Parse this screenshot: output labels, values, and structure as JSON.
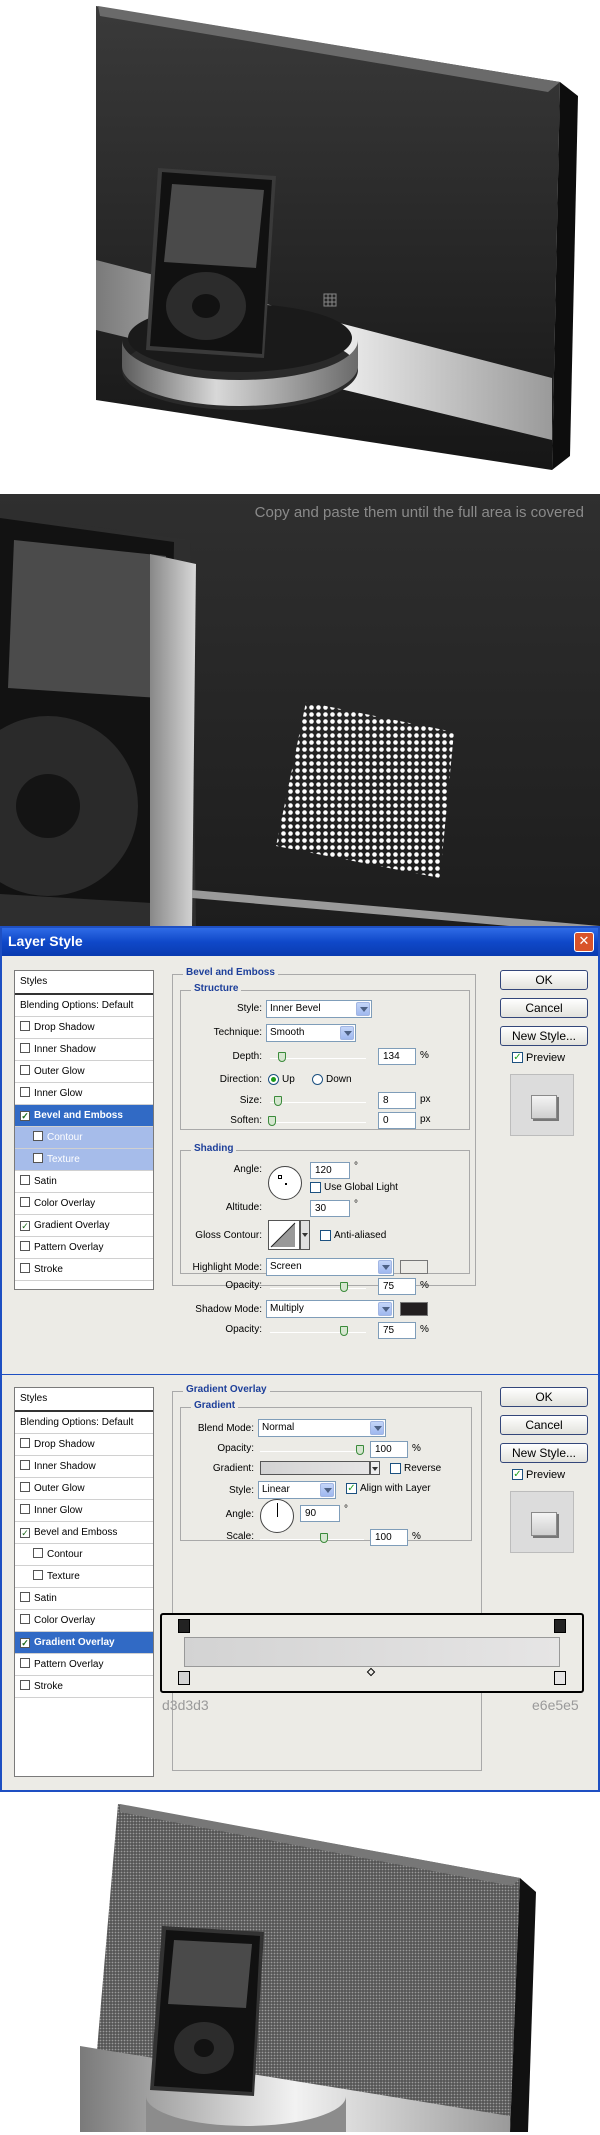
{
  "hint_text": "Copy and paste them until the full area is covered",
  "colors": {
    "dialog_bg": "#ecebe6",
    "titlebar": "#0f48c9",
    "selected": "#316ac5",
    "accent_title": "#1d3f9a",
    "gradient_start": "#d3d3d3",
    "gradient_end": "#e6e5e5"
  },
  "dialog1": {
    "title": "Layer Style",
    "buttons": {
      "ok": "OK",
      "cancel": "Cancel",
      "new_style": "New Style...",
      "preview": "Preview"
    },
    "styles": [
      {
        "label": "Styles",
        "kind": "header"
      },
      {
        "label": "Blending Options: Default",
        "kind": "plain"
      },
      {
        "label": "Drop Shadow",
        "kind": "cb",
        "checked": false
      },
      {
        "label": "Inner Shadow",
        "kind": "cb",
        "checked": false
      },
      {
        "label": "Outer Glow",
        "kind": "cb",
        "checked": false
      },
      {
        "label": "Inner Glow",
        "kind": "cb",
        "checked": false
      },
      {
        "label": "Bevel and Emboss",
        "kind": "cb",
        "checked": true,
        "selected": true
      },
      {
        "label": "Contour",
        "kind": "sub",
        "checked": false,
        "selsub": true
      },
      {
        "label": "Texture",
        "kind": "sub",
        "checked": false,
        "selsub": true
      },
      {
        "label": "Satin",
        "kind": "cb",
        "checked": false
      },
      {
        "label": "Color Overlay",
        "kind": "cb",
        "checked": false
      },
      {
        "label": "Gradient Overlay",
        "kind": "cb",
        "checked": true
      },
      {
        "label": "Pattern Overlay",
        "kind": "cb",
        "checked": false
      },
      {
        "label": "Stroke",
        "kind": "cb",
        "checked": false
      }
    ],
    "section_title": "Bevel and Emboss",
    "structure": {
      "title": "Structure",
      "style_label": "Style:",
      "style_value": "Inner Bevel",
      "technique_label": "Technique:",
      "technique_value": "Smooth",
      "depth_label": "Depth:",
      "depth_value": "134",
      "depth_unit": "%",
      "direction_label": "Direction:",
      "up": "Up",
      "down": "Down",
      "direction_value": "Up",
      "size_label": "Size:",
      "size_value": "8",
      "size_unit": "px",
      "soften_label": "Soften:",
      "soften_value": "0",
      "soften_unit": "px"
    },
    "shading": {
      "title": "Shading",
      "angle_label": "Angle:",
      "angle_value": "120",
      "angle_unit": "°",
      "global_light": "Use Global Light",
      "global_light_checked": false,
      "altitude_label": "Altitude:",
      "altitude_value": "30",
      "altitude_unit": "°",
      "gloss_label": "Gloss Contour:",
      "anti_aliased": "Anti-aliased",
      "anti_aliased_checked": false,
      "highlight_label": "Highlight Mode:",
      "highlight_value": "Screen",
      "highlight_color": "#ffffff",
      "opacity_label": "Opacity:",
      "highlight_opacity": "75",
      "shadow_label": "Shadow Mode:",
      "shadow_value": "Multiply",
      "shadow_color": "#231f20",
      "shadow_opacity": "75",
      "pct": "%"
    }
  },
  "dialog2": {
    "buttons": {
      "ok": "OK",
      "cancel": "Cancel",
      "new_style": "New Style...",
      "preview": "Preview"
    },
    "styles": [
      {
        "label": "Styles",
        "kind": "header"
      },
      {
        "label": "Blending Options: Default",
        "kind": "plain"
      },
      {
        "label": "Drop Shadow",
        "kind": "cb",
        "checked": false
      },
      {
        "label": "Inner Shadow",
        "kind": "cb",
        "checked": false
      },
      {
        "label": "Outer Glow",
        "kind": "cb",
        "checked": false
      },
      {
        "label": "Inner Glow",
        "kind": "cb",
        "checked": false
      },
      {
        "label": "Bevel and Emboss",
        "kind": "cb",
        "checked": true
      },
      {
        "label": "Contour",
        "kind": "sub",
        "checked": false
      },
      {
        "label": "Texture",
        "kind": "sub",
        "checked": false
      },
      {
        "label": "Satin",
        "kind": "cb",
        "checked": false
      },
      {
        "label": "Color Overlay",
        "kind": "cb",
        "checked": false
      },
      {
        "label": "Gradient Overlay",
        "kind": "cb",
        "checked": true,
        "selected": true
      },
      {
        "label": "Pattern Overlay",
        "kind": "cb",
        "checked": false
      },
      {
        "label": "Stroke",
        "kind": "cb",
        "checked": false
      }
    ],
    "section_title": "Gradient Overlay",
    "gradient": {
      "title": "Gradient",
      "blend_label": "Blend Mode:",
      "blend_value": "Normal",
      "opacity_label": "Opacity:",
      "opacity_value": "100",
      "pct": "%",
      "gradient_label": "Gradient:",
      "reverse": "Reverse",
      "reverse_checked": false,
      "style_label": "Style:",
      "style_value": "Linear",
      "align": "Align with Layer",
      "align_checked": true,
      "angle_label": "Angle:",
      "angle_value": "90",
      "angle_unit": "°",
      "scale_label": "Scale:",
      "scale_value": "100"
    },
    "stop_left": "d3d3d3",
    "stop_right": "e6e5e5"
  }
}
